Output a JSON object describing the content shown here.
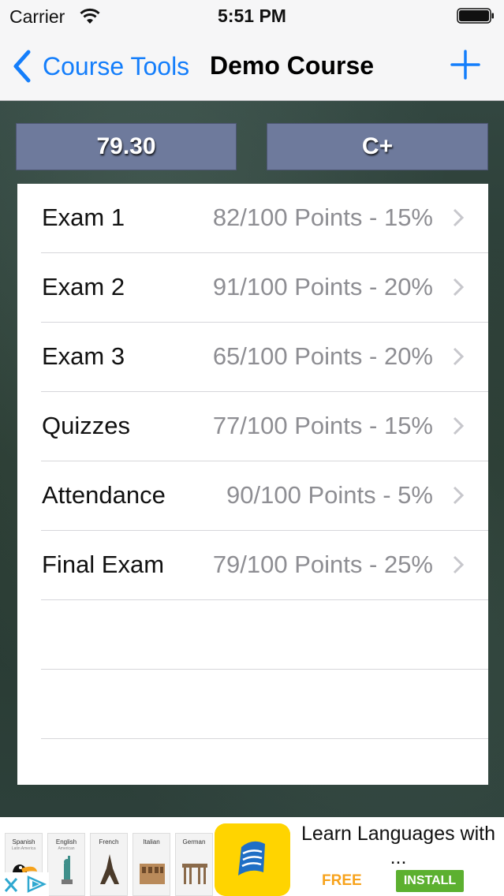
{
  "status_bar": {
    "carrier": "Carrier",
    "time": "5:51 PM"
  },
  "nav": {
    "back_label": "Course Tools",
    "title": "Demo Course"
  },
  "summary": {
    "score": "79.30",
    "letter_grade": "C+"
  },
  "grade_items": [
    {
      "name": "Exam 1",
      "detail": "82/100 Points - 15%"
    },
    {
      "name": "Exam 2",
      "detail": "91/100 Points - 20%"
    },
    {
      "name": "Exam 3",
      "detail": "65/100 Points - 20%"
    },
    {
      "name": "Quizzes",
      "detail": "77/100 Points - 15%"
    },
    {
      "name": "Attendance",
      "detail": "90/100 Points - 5%"
    },
    {
      "name": "Final Exam",
      "detail": "79/100 Points - 25%"
    }
  ],
  "ad": {
    "headline": "Learn Languages with ...",
    "free_label": "FREE",
    "install_label": "INSTALL",
    "tiles": [
      {
        "label": "Spanish",
        "sub": "Latin America"
      },
      {
        "label": "English",
        "sub": "American"
      },
      {
        "label": "French",
        "sub": ""
      },
      {
        "label": "Italian",
        "sub": ""
      },
      {
        "label": "German",
        "sub": ""
      }
    ]
  },
  "colors": {
    "accent": "#147efb",
    "score_box": "#6e7a9c",
    "ad_logo": "#ffd400",
    "install": "#5cb030",
    "free": "#f7a21b"
  }
}
